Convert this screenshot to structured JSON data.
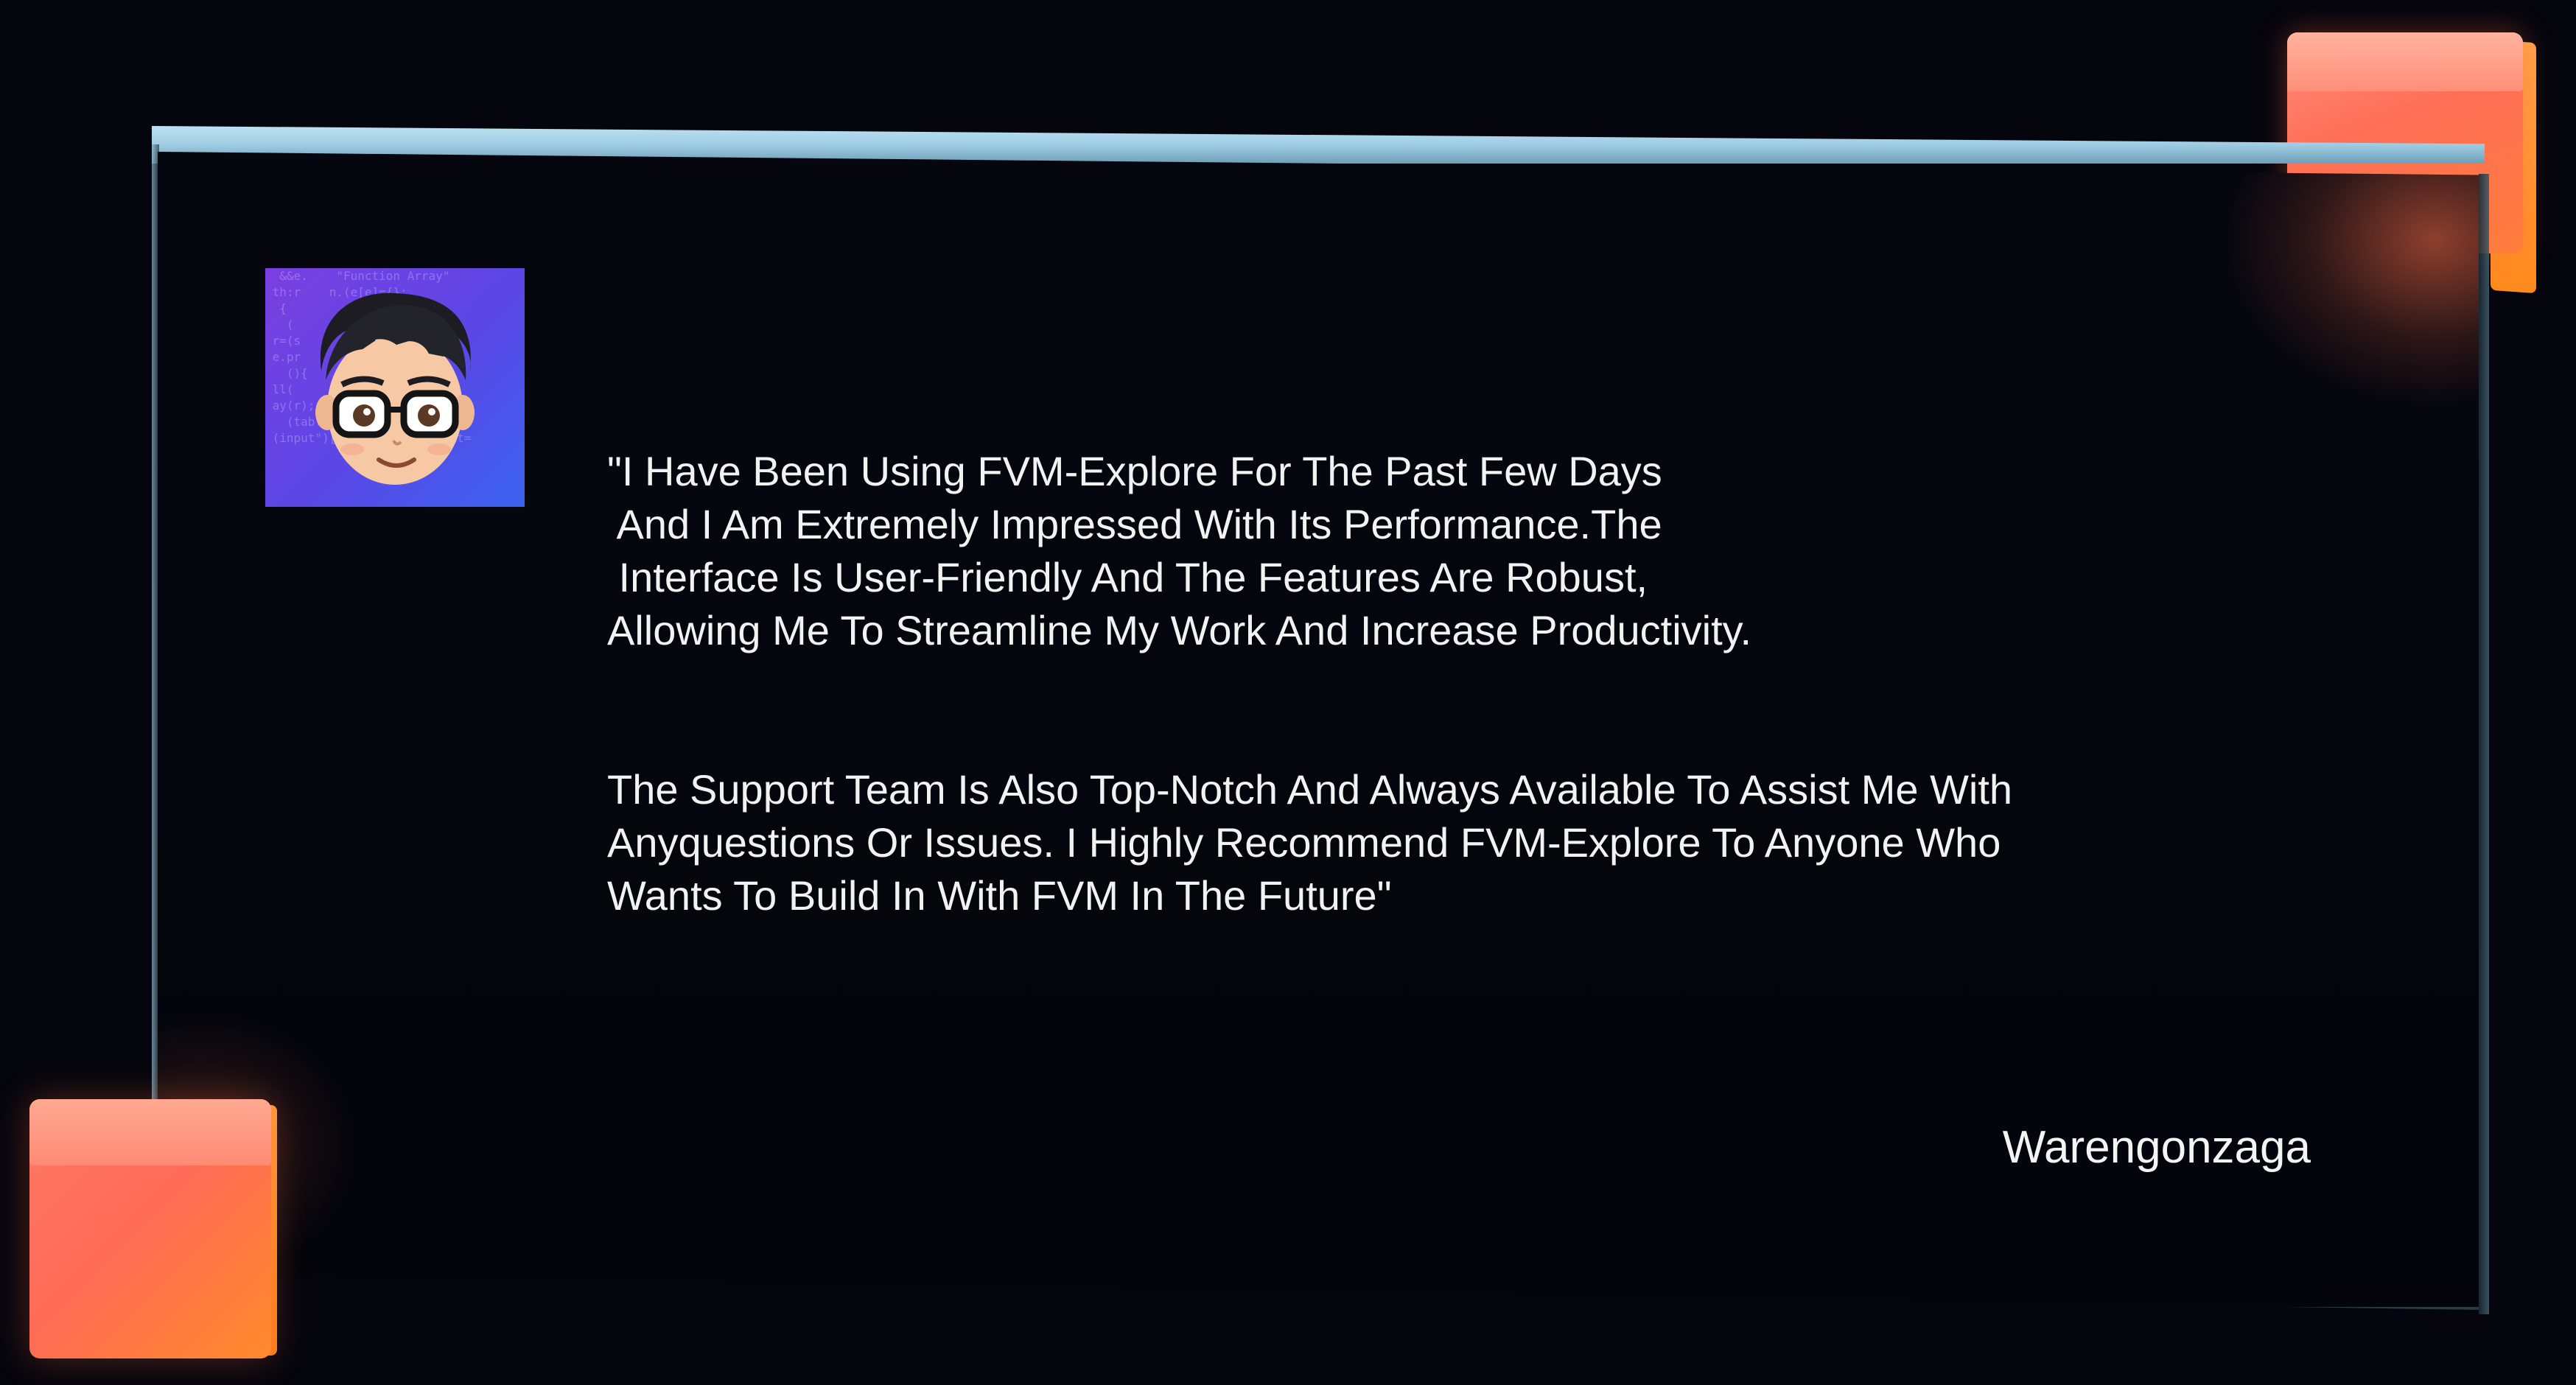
{
  "testimonial": {
    "paragraph_1": "\"I Have Been Using FVM-Explore For The Past Few Days\n And I Am Extremely Impressed With Its Performance.The\n Interface Is User-Friendly And The Features Are Robust,\nAllowing Me To Streamline My Work And Increase Productivity.",
    "paragraph_2": "The Support Team Is Also Top-Notch And Always Available To Assist Me With\nAnyquestions Or Issues. I Highly Recommend FVM-Explore To Anyone Who\nWants To Build In With FVM In The Future\"",
    "author": "Warengonzaga"
  },
  "avatar": {
    "icon": "cartoon-avatar-icon"
  },
  "colors": {
    "background": "#05050d",
    "card": "#06060f",
    "rim": "#c6e7f5",
    "cube_primary": "#ff6f57",
    "cube_secondary": "#ff8a1e",
    "avatar_bg_start": "#7b3fe0",
    "avatar_bg_end": "#3a63ef",
    "text": "#f2f2f2"
  }
}
